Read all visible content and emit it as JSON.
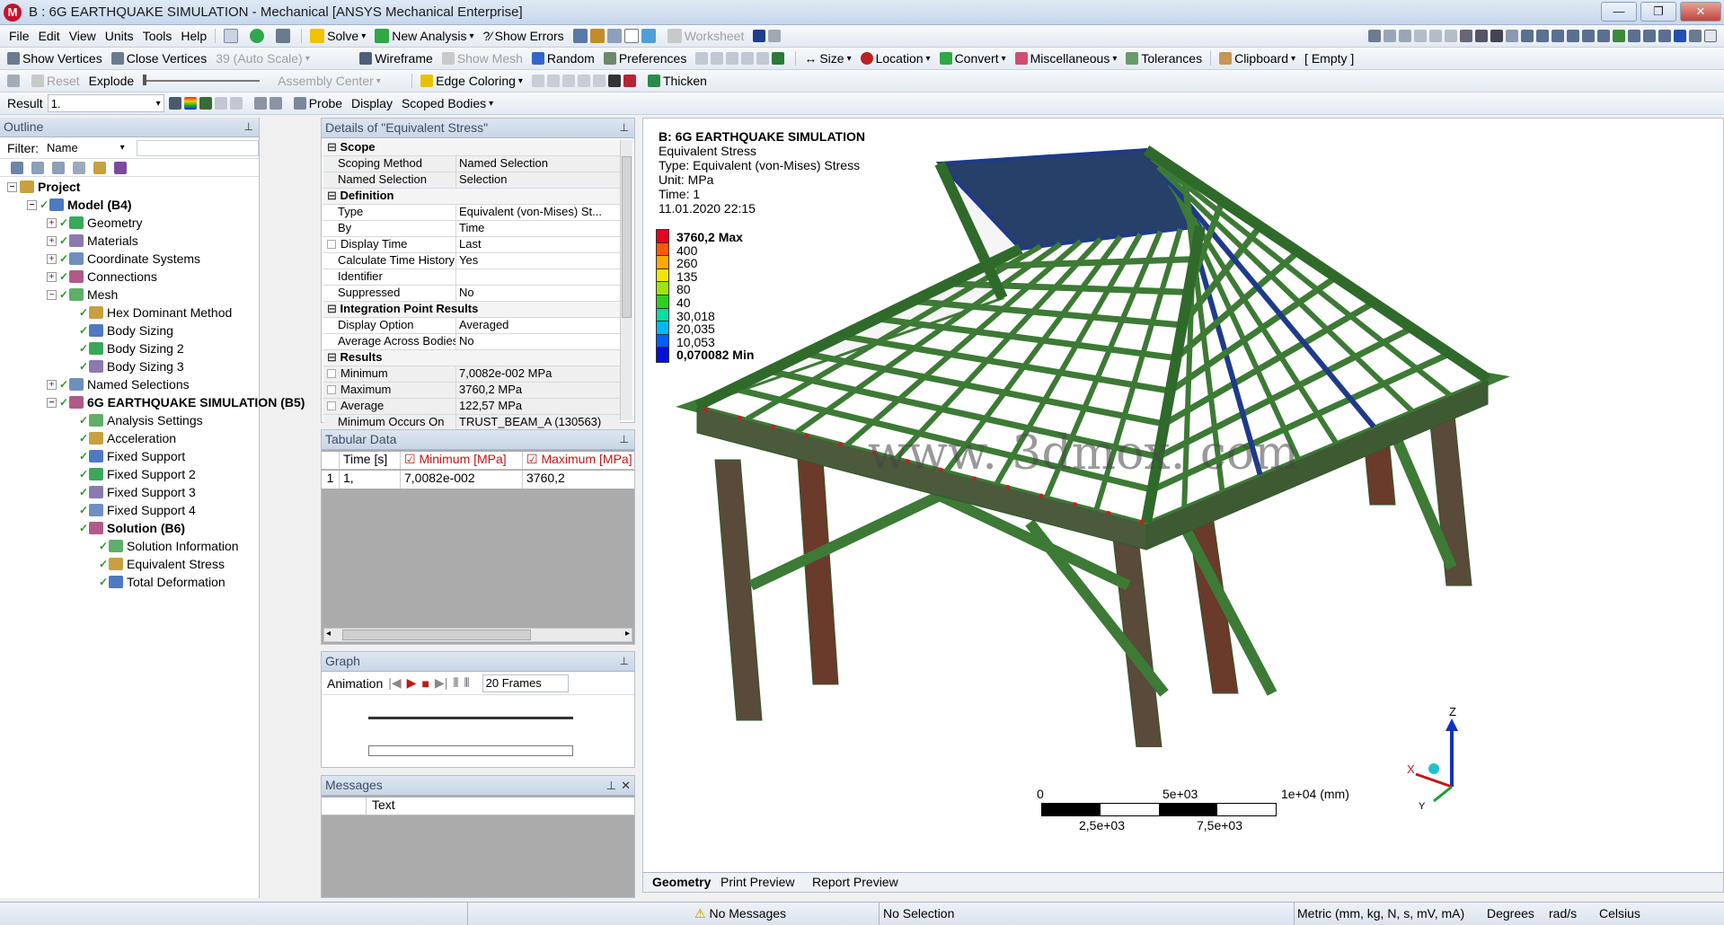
{
  "window": {
    "title": "B : 6G EARTHQUAKE SIMULATION - Mechanical [ANSYS Mechanical Enterprise]",
    "logo": "M",
    "min": "—",
    "max": "❐",
    "close": "✕"
  },
  "menu": [
    "File",
    "Edit",
    "View",
    "Units",
    "Tools",
    "Help"
  ],
  "toolbar1": {
    "solve": "Solve",
    "new_analysis": "New Analysis",
    "show_errors": "Show Errors",
    "worksheet": "Worksheet"
  },
  "toolbar2": {
    "show_vertices": "Show Vertices",
    "close_vertices": "Close Vertices",
    "auto_scale": "39 (Auto Scale)",
    "wireframe": "Wireframe",
    "show_mesh": "Show Mesh",
    "random": "Random",
    "preferences": "Preferences",
    "size": "Size",
    "location": "Location",
    "convert": "Convert",
    "miscellaneous": "Miscellaneous",
    "tolerances": "Tolerances",
    "clipboard": "Clipboard",
    "empty": "[ Empty ]"
  },
  "toolbar3": {
    "reset": "Reset",
    "explode": "Explode",
    "assembly_center": "Assembly Center",
    "edge_coloring": "Edge Coloring",
    "thicken": "Thicken"
  },
  "toolbar4": {
    "result_label": "Result",
    "result_value": "1.",
    "probe": "Probe",
    "display_label": "Display",
    "display_value": "Scoped Bodies"
  },
  "outline": {
    "header": "Outline",
    "filter_label": "Filter:",
    "filter_value": "Name",
    "items": [
      {
        "label": "Project",
        "level": 0,
        "bold": true
      },
      {
        "label": "Model (B4)",
        "level": 1,
        "bold": true
      },
      {
        "label": "Geometry",
        "level": 2
      },
      {
        "label": "Materials",
        "level": 2
      },
      {
        "label": "Coordinate Systems",
        "level": 2
      },
      {
        "label": "Connections",
        "level": 2
      },
      {
        "label": "Mesh",
        "level": 2
      },
      {
        "label": "Hex Dominant Method",
        "level": 3
      },
      {
        "label": "Body Sizing",
        "level": 3
      },
      {
        "label": "Body Sizing 2",
        "level": 3
      },
      {
        "label": "Body Sizing 3",
        "level": 3
      },
      {
        "label": "Named Selections",
        "level": 2
      },
      {
        "label": "6G EARTHQUAKE SIMULATION (B5)",
        "level": 2,
        "bold": true
      },
      {
        "label": "Analysis Settings",
        "level": 3
      },
      {
        "label": "Acceleration",
        "level": 3
      },
      {
        "label": "Fixed Support",
        "level": 3
      },
      {
        "label": "Fixed Support 2",
        "level": 3
      },
      {
        "label": "Fixed Support 3",
        "level": 3
      },
      {
        "label": "Fixed Support 4",
        "level": 3
      },
      {
        "label": "Solution (B6)",
        "level": 3,
        "bold": true
      },
      {
        "label": "Solution Information",
        "level": 4
      },
      {
        "label": "Equivalent Stress",
        "level": 4
      },
      {
        "label": "Total Deformation",
        "level": 4
      }
    ]
  },
  "details": {
    "header": "Details of \"Equivalent Stress\"",
    "rows": [
      {
        "group": "Scope"
      },
      {
        "k": "Scoping Method",
        "v": "Named Selection",
        "grey": true
      },
      {
        "k": "Named Selection",
        "v": "Selection",
        "grey": true
      },
      {
        "group": "Definition"
      },
      {
        "k": "Type",
        "v": "Equivalent (von-Mises) St..."
      },
      {
        "k": "By",
        "v": "Time"
      },
      {
        "k": "Display Time",
        "v": "Last",
        "box": true
      },
      {
        "k": "Calculate Time History",
        "v": "Yes"
      },
      {
        "k": "Identifier",
        "v": ""
      },
      {
        "k": "Suppressed",
        "v": "No"
      },
      {
        "group": "Integration Point Results"
      },
      {
        "k": "Display Option",
        "v": "Averaged"
      },
      {
        "k": "Average Across Bodies",
        "v": "No"
      },
      {
        "group": "Results"
      },
      {
        "k": "Minimum",
        "v": "7,0082e-002 MPa",
        "box": true,
        "grey": true
      },
      {
        "k": "Maximum",
        "v": "3760,2 MPa",
        "box": true,
        "grey": true
      },
      {
        "k": "Average",
        "v": "122,57 MPa",
        "box": true,
        "grey": true
      },
      {
        "k": "Minimum Occurs On",
        "v": "TRUST_BEAM_A (130563)",
        "grey": true
      }
    ]
  },
  "tabular": {
    "header": "Tabular Data",
    "col_time": "Time [s]",
    "col_min": "Minimum [MPa]",
    "col_max": "Maximum [MPa]",
    "row_index": "1",
    "row_time": "1,",
    "row_min": "7,0082e-002",
    "row_max": "3760,2"
  },
  "graph": {
    "header": "Graph",
    "animation": "Animation",
    "frames": "20 Frames"
  },
  "messages": {
    "header": "Messages",
    "col_text": "Text"
  },
  "viewport": {
    "title": "B: 6G EARTHQUAKE SIMULATION",
    "line1": "Equivalent Stress",
    "line2": "Type: Equivalent (von-Mises) Stress",
    "line3": "Unit: MPa",
    "line4": "Time: 1",
    "line5": "11.01.2020 22:15",
    "watermark": "www. 3dmox. com",
    "legend": [
      {
        "label": "3760,2 Max",
        "color": "#e8001c",
        "bold": true
      },
      {
        "label": "400",
        "color": "#ff5a00"
      },
      {
        "label": "260",
        "color": "#ffa800"
      },
      {
        "label": "135",
        "color": "#f2e600"
      },
      {
        "label": "80",
        "color": "#9ee600"
      },
      {
        "label": "40",
        "color": "#28d21e"
      },
      {
        "label": "30,018",
        "color": "#00e0a0"
      },
      {
        "label": "20,035",
        "color": "#00b8ff"
      },
      {
        "label": "10,053",
        "color": "#0060ff"
      },
      {
        "label": "0,070082 Min",
        "color": "#0010d8",
        "bold": true
      }
    ],
    "scale": {
      "t0": "0",
      "t1": "5e+03",
      "t2": "1e+04 (mm)",
      "b1": "2,5e+03",
      "b2": "7,5e+03"
    },
    "axes": {
      "z": "Z",
      "x": "X",
      "y": "Y"
    },
    "tabs": [
      "Geometry",
      "Print Preview",
      "Report Preview"
    ]
  },
  "status": {
    "messages": "No Messages",
    "selection": "No Selection",
    "units": "Metric (mm, kg, N, s, mV, mA)",
    "degrees": "Degrees",
    "rads": "rad/s",
    "celsius": "Celsius"
  }
}
